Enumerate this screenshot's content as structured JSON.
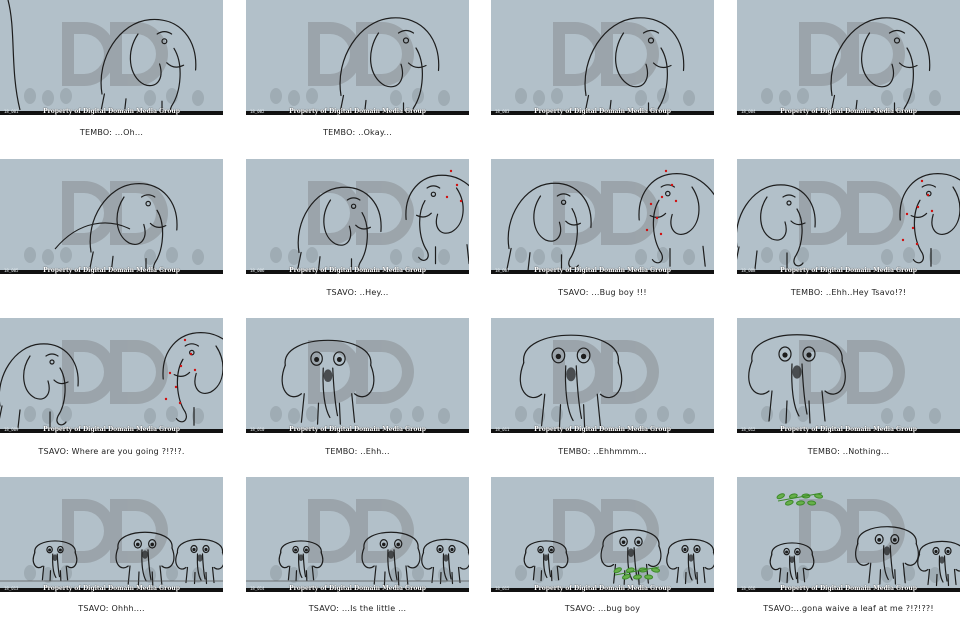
{
  "watermark": "Property of Digital Domain Media Group",
  "logo_text": "DD",
  "colors": {
    "panel_bg": "#b2c0c9",
    "logo": "#98a0a6",
    "ink": "#1d1d1d",
    "bar": "#111111"
  },
  "panels": [
    {
      "caption": "TEMBO: ...Oh...",
      "timecode": "18_001",
      "scene": "tembo-lean-left"
    },
    {
      "caption": "TEMBO: ..Okay...",
      "timecode": "18_002",
      "scene": "tembo-lean"
    },
    {
      "caption": "",
      "timecode": "18_003",
      "scene": "tembo-lean"
    },
    {
      "caption": "",
      "timecode": "18_004",
      "scene": "tembo-lean"
    },
    {
      "caption": "",
      "timecode": "18_005",
      "scene": "tembo-crouch"
    },
    {
      "caption": "TSAVO: ..Hey...",
      "timecode": "18_006",
      "scene": "tembo-meets-tsavo"
    },
    {
      "caption": "TSAVO: ...Bug boy !!!",
      "timecode": "18_007",
      "scene": "face-off"
    },
    {
      "caption": "TEMBO: ..Ehh..Hey Tsavo!?!",
      "timecode": "18_008",
      "scene": "face-off-close"
    },
    {
      "caption": "TSAVO: Where are you going ?!?!?.",
      "timecode": "18_009",
      "scene": "face-off-close"
    },
    {
      "caption": "TEMBO: ..Ehh...",
      "timecode": "18_010",
      "scene": "tembo-front"
    },
    {
      "caption": "TEMBO: ..Ehhmmm...",
      "timecode": "18_011",
      "scene": "tembo-front-big"
    },
    {
      "caption": "TEMBO: ..Nothing...",
      "timecode": "18_012",
      "scene": "tembo-front-right"
    },
    {
      "caption": "TSAVO: Ohhh....",
      "timecode": "18_013",
      "scene": "group"
    },
    {
      "caption": "TSAVO: ...Is the little ...",
      "timecode": "18_014",
      "scene": "group"
    },
    {
      "caption": "TSAVO: ...bug boy",
      "timecode": "18_015",
      "scene": "group-leaf"
    },
    {
      "caption": "TSAVO:...gona waive a leaf at me ?!?!??!",
      "timecode": "18_016",
      "scene": "group-leaf-up"
    }
  ]
}
